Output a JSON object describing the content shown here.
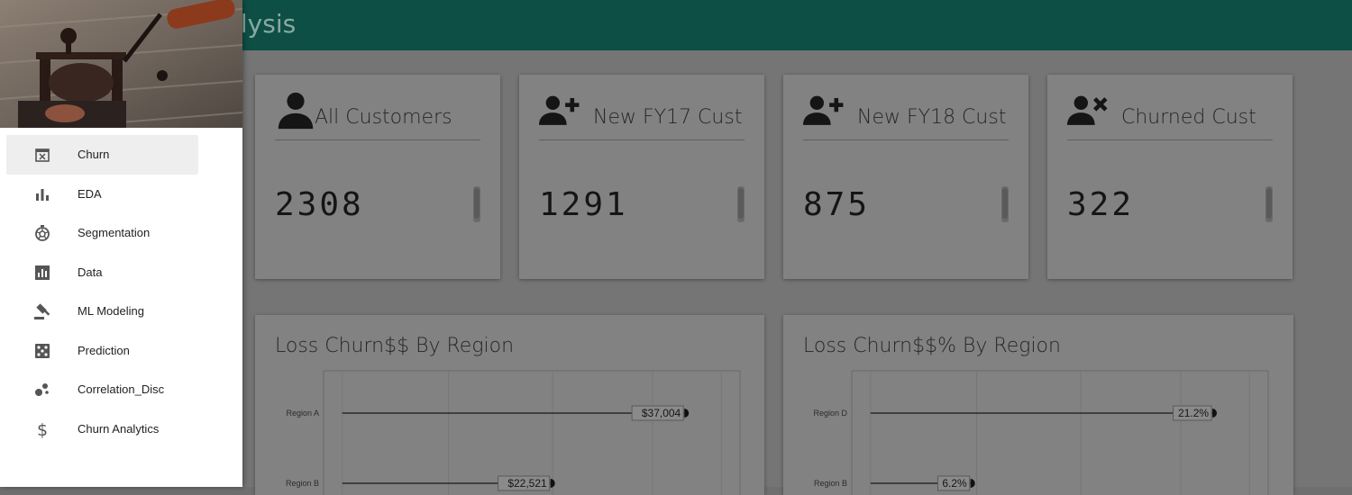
{
  "header": {
    "title": "nalysis"
  },
  "kpis": [
    {
      "label": "All Customers",
      "value": "2308",
      "icon": "person-icon"
    },
    {
      "label": "New FY17 Cust",
      "value": "1291",
      "icon": "person-add-icon"
    },
    {
      "label": "New FY18 Cust",
      "value": "875",
      "icon": "person-add-icon"
    },
    {
      "label": "Churned Cust",
      "value": "322",
      "icon": "person-remove-icon"
    }
  ],
  "charts": [
    {
      "title": "Loss Churn$$ By Region"
    },
    {
      "title": "Loss Churn$$% By Region"
    }
  ],
  "chart_data": [
    {
      "type": "bar",
      "title": "Loss Churn$$ By Region",
      "categories": [
        "Region A",
        "Region B"
      ],
      "values": [
        37004,
        22521
      ],
      "value_labels": [
        "$37,004",
        "$22,521"
      ],
      "xlim": [
        0,
        41000
      ]
    },
    {
      "type": "bar",
      "title": "Loss Churn$$% By Region",
      "categories": [
        "Region D",
        "Region B"
      ],
      "values": [
        21.2,
        6.2
      ],
      "value_labels": [
        "21.2%",
        "6.2%"
      ],
      "xlim": [
        0,
        23.5
      ]
    }
  ],
  "sidebar": {
    "items": [
      {
        "label": "Churn",
        "icon": "calendar-x-icon",
        "active": true
      },
      {
        "label": "EDA",
        "icon": "bar-chart-icon"
      },
      {
        "label": "Segmentation",
        "icon": "aperture-icon"
      },
      {
        "label": "Data",
        "icon": "chart-box-icon"
      },
      {
        "label": "ML Modeling",
        "icon": "gavel-icon"
      },
      {
        "label": "Prediction",
        "icon": "dice-icon"
      },
      {
        "label": "Correlation_Disc",
        "icon": "bubbles-icon"
      },
      {
        "label": "Churn Analytics",
        "icon": "dollar-icon"
      }
    ]
  },
  "colors": {
    "header": "#0d4f45",
    "overlay_card": "#828282",
    "sidebar_bg": "#ffffff"
  }
}
